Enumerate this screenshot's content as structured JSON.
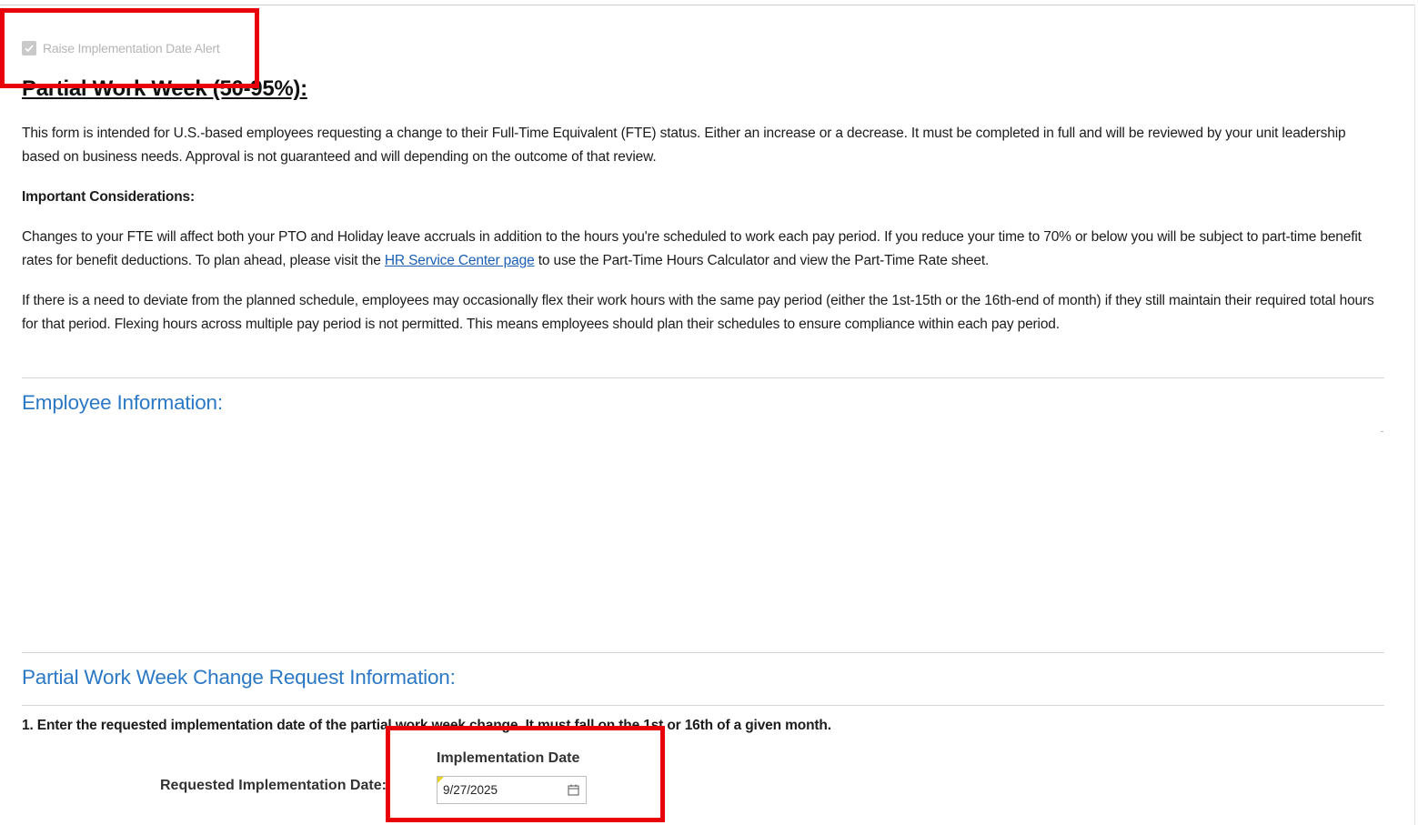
{
  "alert": {
    "checked": true,
    "label": "Raise Implementation Date Alert"
  },
  "page": {
    "title": "Partial Work Week (50-95%):",
    "intro": "This form is intended for U.S.-based employees requesting a change to their Full-Time Equivalent (FTE) status. Either an increase or a decrease. It must be completed in full and will be reviewed by your unit leadership based on business needs. Approval is not guaranteed and will depending on the outcome of that review.",
    "considerations_heading": "Important Considerations:",
    "considerations_part1": "Changes to your FTE will affect both your PTO and Holiday leave accruals in addition to the hours you're scheduled to work each pay period. If you reduce your time to 70% or below you will be subject to part-time benefit rates for benefit deductions. To plan ahead, please visit the ",
    "considerations_link": "HR Service Center page",
    "considerations_part2": " to use the Part-Time Hours Calculator and view the Part-Time Rate sheet.",
    "flex_paragraph": "If there is a need to deviate from the planned schedule, employees may occasionally flex their work hours with the same pay period (either the 1st-15th or the 16th-end of month) if they still maintain their required total hours for that period. Flexing hours across multiple pay period is not permitted. This means employees should plan their schedules to ensure compliance within each pay period."
  },
  "sections": {
    "employee_info": "Employee Information:",
    "change_request": "Partial Work Week Change Request Information:"
  },
  "question1": {
    "text": "1. Enter the requested implementation date of the partial work week change. It must fall on the 1st or 16th of a given month.",
    "field_label": "Requested Implementation Date:",
    "column_label": "Implementation Date",
    "value": "9/27/2025"
  },
  "colors": {
    "section_title": "#2b78c5",
    "link": "#1a5fb4",
    "highlight_box": "#e8000b",
    "required_flag": "#e7d320"
  },
  "icons": {
    "checkbox": "checkmark-icon",
    "date_picker": "calendar-icon"
  }
}
